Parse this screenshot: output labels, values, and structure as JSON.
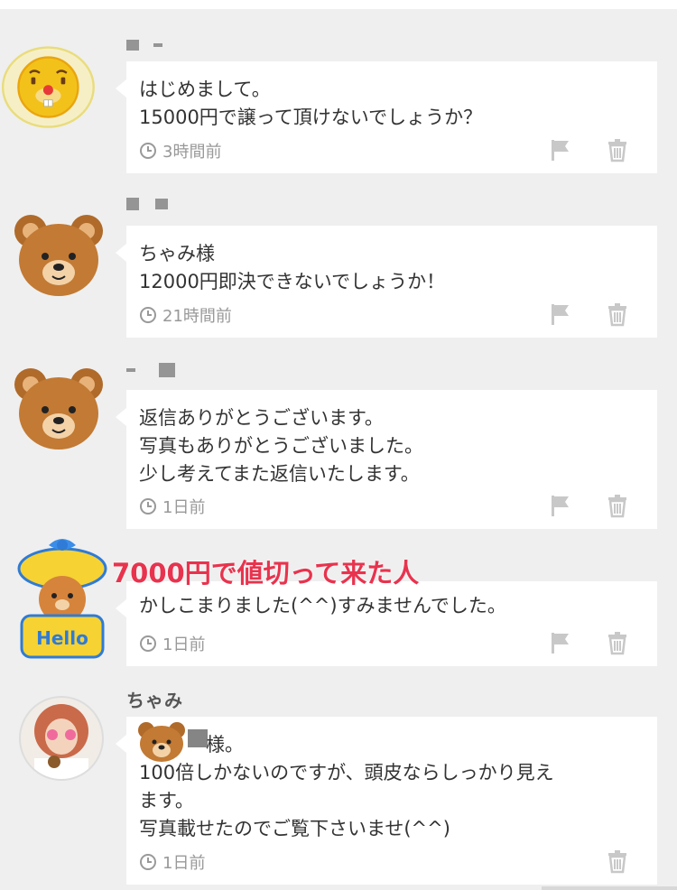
{
  "comments": [
    {
      "username": "",
      "lines": [
        "はじめまして。",
        "15000円で譲って頂けないでしょうか？"
      ],
      "time": "3時間前",
      "avatar_icon": "beaver-face-icon",
      "has_flag": true
    },
    {
      "username": "",
      "lines": [
        "ちゃみ様",
        "12000円即決できないでしょうか！"
      ],
      "time": "21時間前",
      "avatar_icon": "teddy-bear-face-icon",
      "has_flag": true
    },
    {
      "username": "",
      "lines": [
        "返信ありがとうございます。",
        "写真もありがとうございました。",
        "少し考えてまた返信いたします。"
      ],
      "time": "1日前",
      "avatar_icon": "teddy-bear-face-icon",
      "has_flag": true
    },
    {
      "username": "",
      "lines": [
        "かしこまりました(^^)すみませんでした。"
      ],
      "time": "1日前",
      "avatar_icon": "hello-bear-sticker-icon",
      "has_flag": true
    },
    {
      "username": "ちゃみ",
      "lines": [
        "様。",
        "100倍しかないのですが、頭皮ならしっかり見え",
        "ます。",
        "写真載せたのでご覧下さいませ(^^)"
      ],
      "time": "1日前",
      "avatar_icon": "user-photo-avatar",
      "has_flag": false
    }
  ],
  "annotation": "7000円で値切って来た人",
  "colors": {
    "background": "#efefef",
    "bubble": "#ffffff",
    "meta_text": "#999999",
    "annotation": "#e8334e"
  }
}
